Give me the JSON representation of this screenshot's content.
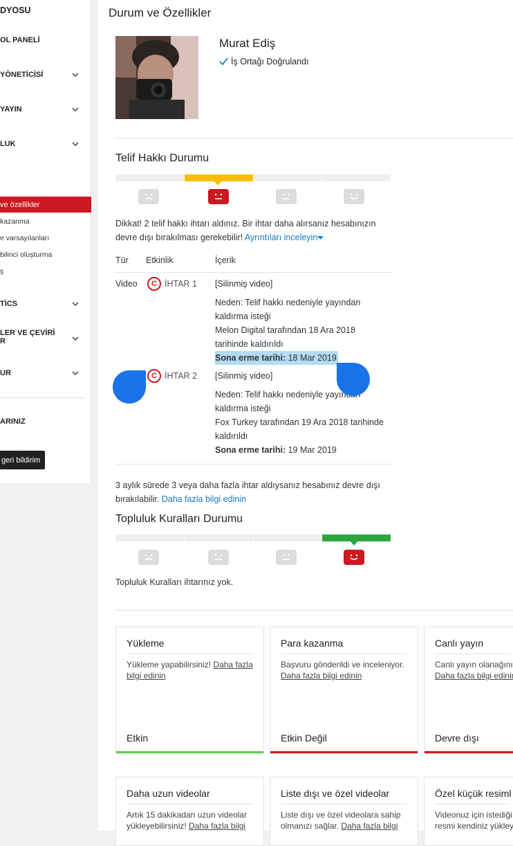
{
  "sidebar": {
    "items": [
      {
        "label": "DYOSU"
      },
      {
        "label": "OL PANELİ"
      },
      {
        "label": "YÖNETİCİSİ"
      },
      {
        "label": "YAYIN"
      },
      {
        "label": "LUK"
      },
      {
        "label": "TİCS"
      },
      {
        "label": "LER VE ÇEVİRİ"
      },
      {
        "label": "R"
      },
      {
        "label": "UR"
      },
      {
        "label": "ARINIZ"
      }
    ],
    "active": "ve özellikler",
    "subitems": [
      "kazanma",
      "e varsayılanları",
      "bilinci oluşturma",
      "ş"
    ],
    "feedback": "geri bildirim"
  },
  "page_title": "Durum ve Özellikler",
  "profile": {
    "name": "Murat Ediş",
    "verified": "İş Ortağı Doğrulandı"
  },
  "copyright": {
    "title": "Telif Hakkı Durumu",
    "active_segment": 2,
    "notice": "Dikkat! 2 telif hakkı ihtarı aldınız. Bir ihtar daha alırsanız hesabınızın devre dışı bırakılması gerekebilir!",
    "notice_link": "Ayrıntıları inceleyin",
    "headers": [
      "Tür",
      "Etkinlik",
      "İçerik"
    ],
    "type_value": "Video",
    "strikes": [
      {
        "label": "İHTAR 1",
        "content_link": "[Silinmiş video]",
        "reason_1": "Neden: Telif hakkı nedeniyle yayından",
        "reason_2": "kaldırma isteği",
        "removed_1": "Melon Digital tarafından 18 Ara 2018",
        "removed_2": "tarihinde kaldırıldı",
        "expiry_label": "Sona erme tarihi:",
        "expiry_value": "18 Mar 2019"
      },
      {
        "label": "İHTAR 2",
        "content_link": "[Silinmiş video]",
        "reason_1": "Neden: Telif hakkı nedeniyle yayından",
        "reason_2": "kaldırma isteği",
        "removed_1": "Fox Turkey tarafından 19 Ara 2018 tarihinde",
        "removed_2": "kaldırıldı",
        "expiry_label": "Sona erme tarihi:",
        "expiry_value": "19 Mar 2019"
      }
    ],
    "footer_1": "3 aylık sürede 3 veya daha fazla ihtar aldıysanız hesabınız devre dışı",
    "footer_2": "bırakılabilir.",
    "footer_link": "Daha fazla bilgi edinin"
  },
  "community": {
    "title": "Topluluk Kuralları Durumu",
    "active_segment": 4,
    "note": "Topluluk Kuralları ihtarınız yok."
  },
  "colors": {
    "red": "#cc181e",
    "yellow": "#fbbc04",
    "green": "#2ba640",
    "link": "#167ac6",
    "blue_marker": "#1a73e8"
  },
  "features": [
    {
      "title": "Yükleme",
      "body": "Yükleme yapabilirsiniz!",
      "link": "Daha fazla bilgi edinin",
      "status": "Etkin",
      "status_color": "#5fd34d"
    },
    {
      "title": "Para kazanma",
      "body": "Başvuru gönderildi ve inceleniyor.",
      "link": "Daha fazla bilgi edinin",
      "status": "Etkin Değil",
      "status_color": "#cc181e"
    },
    {
      "title": "Canlı yayın",
      "body": "Canlı yayın olanağınız",
      "link": "Daha fazla bilgi edinin",
      "status": "Devre dışı",
      "status_color": "#cc181e"
    },
    {
      "title": "Daha uzun videolar",
      "body": "Artık 15 dakikadan uzun videolar yükleyebilirsiniz!",
      "link": "Daha fazla bilgi"
    },
    {
      "title": "Liste dışı ve özel videolar",
      "body": "Liste dışı ve özel videolara sahip olmanızı sağlar.",
      "link": "Daha fazla bilgi"
    },
    {
      "title": "Özel küçük resiml",
      "body": "Videonuz için istediği resmi kendiniz yükley"
    }
  ]
}
